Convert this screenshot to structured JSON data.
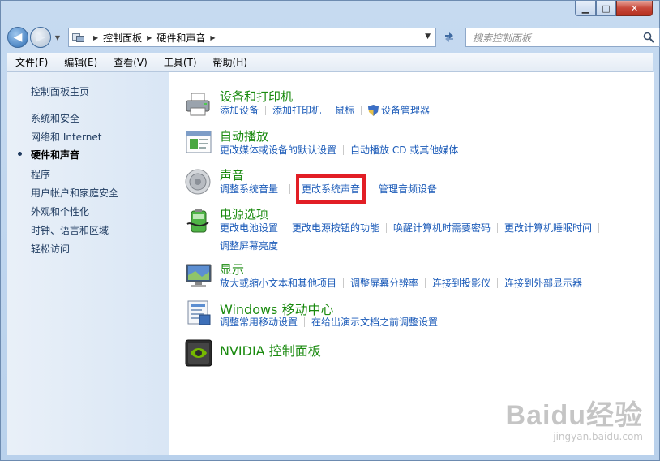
{
  "window": {
    "minimize_glyph": "▁",
    "maximize_glyph": "□",
    "close_glyph": "✕"
  },
  "nav": {
    "back_glyph": "◀",
    "forward_glyph": "▶",
    "breadcrumbs": [
      "控制面板",
      "硬件和声音"
    ],
    "search_placeholder": "搜索控制面板"
  },
  "menu": [
    "文件(F)",
    "编辑(E)",
    "查看(V)",
    "工具(T)",
    "帮助(H)"
  ],
  "sidebar": {
    "items": [
      {
        "label": "控制面板主页",
        "active": false
      },
      {
        "label": "系统和安全",
        "active": false
      },
      {
        "label": "网络和 Internet",
        "active": false
      },
      {
        "label": "硬件和声音",
        "active": true
      },
      {
        "label": "程序",
        "active": false
      },
      {
        "label": "用户帐户和家庭安全",
        "active": false
      },
      {
        "label": "外观和个性化",
        "active": false
      },
      {
        "label": "时钟、语言和区域",
        "active": false
      },
      {
        "label": "轻松访问",
        "active": false
      }
    ]
  },
  "categories": [
    {
      "title": "设备和打印机",
      "icon": "printer-icon",
      "links": [
        "添加设备",
        "添加打印机",
        "鼠标",
        "设备管理器"
      ]
    },
    {
      "title": "自动播放",
      "icon": "autoplay-icon",
      "links": [
        "更改媒体或设备的默认设置",
        "自动播放 CD 或其他媒体"
      ]
    },
    {
      "title": "声音",
      "icon": "speaker-icon",
      "links": [
        "调整系统音量",
        "更改系统声音",
        "管理音频设备"
      ]
    },
    {
      "title": "电源选项",
      "icon": "battery-icon",
      "links": [
        "更改电池设置",
        "更改电源按钮的功能",
        "唤醒计算机时需要密码",
        "更改计算机睡眠时间",
        "调整屏幕亮度"
      ]
    },
    {
      "title": "显示",
      "icon": "monitor-icon",
      "links": [
        "放大或缩小文本和其他项目",
        "调整屏幕分辨率",
        "连接到投影仪",
        "连接到外部显示器"
      ]
    },
    {
      "title": "Windows 移动中心",
      "icon": "mobility-center-icon",
      "links": [
        "调整常用移动设置",
        "在给出演示文档之前调整设置"
      ]
    },
    {
      "title": "NVIDIA 控制面板",
      "icon": "nvidia-icon",
      "links": []
    }
  ],
  "highlight": "更改系统声音",
  "watermark": {
    "line1": "Baidu经验",
    "line2": "jingyan.baidu.com"
  }
}
